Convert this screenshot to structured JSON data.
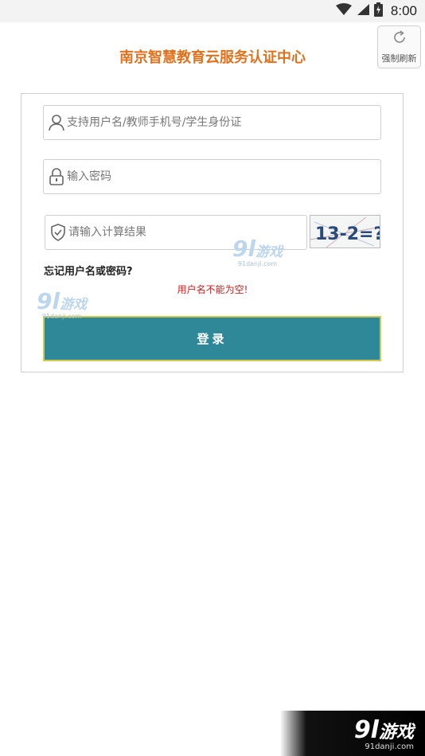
{
  "status_bar": {
    "time": "8:00",
    "icons": [
      "wifi-icon",
      "cellular-signal-icon",
      "battery-charging-icon"
    ]
  },
  "header": {
    "title": "南京智慧教育云服务认证中心",
    "refresh_label": "强制刷新"
  },
  "form": {
    "username_placeholder": "支持用户名/教师手机号/学生身份证",
    "username_value": "",
    "password_placeholder": "输入密码",
    "password_value": "",
    "captcha_placeholder": "请输入计算结果",
    "captcha_value": "",
    "captcha_text": "13-2=?",
    "forgot_label": "忘记用户名或密码?",
    "error_message": "用户名不能为空!",
    "login_label": "登录"
  },
  "watermark": {
    "number": "9l",
    "name": "游戏",
    "url": "91danji.com"
  },
  "colors": {
    "title": "#e0721e",
    "button": "#2e8897",
    "button_border": "#d3c94f",
    "error": "#cc1f1f"
  }
}
